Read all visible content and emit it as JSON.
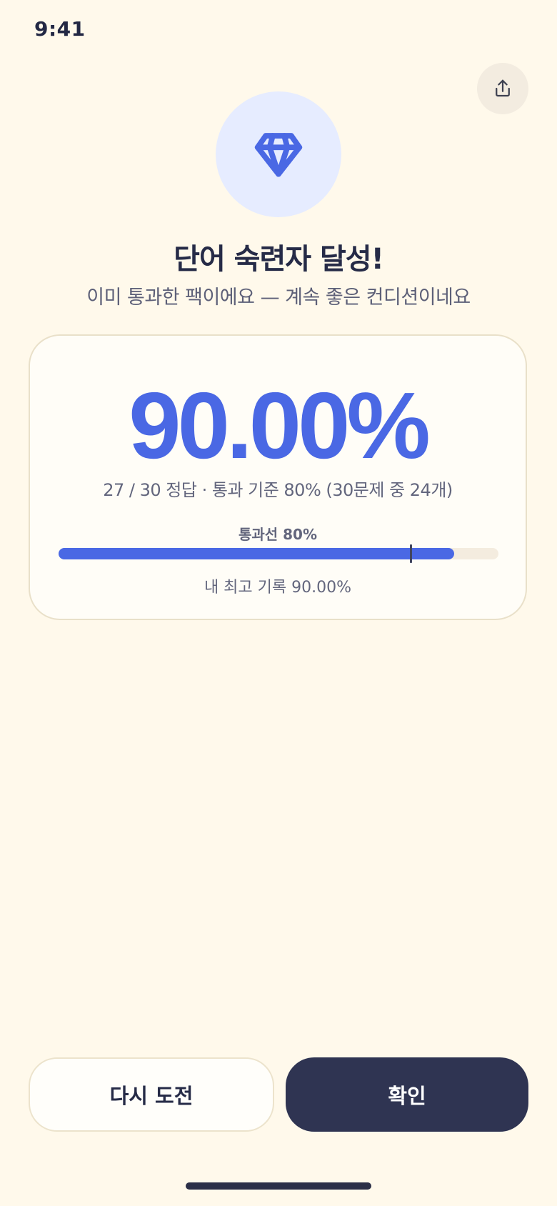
{
  "status_bar": {
    "time": "9:41"
  },
  "share": {
    "icon": "share-icon"
  },
  "hero": {
    "icon": "diamond-icon",
    "accent": "#4a68e4",
    "circle_bg": "#e6ecff"
  },
  "title": "단어 숙련자 달성!",
  "subtitle": "이미 통과한 팩이에요 — 계속 좋은 컨디션이네요",
  "result": {
    "score": "90.00%",
    "detail": "27 / 30 정답 · 통과 기준 80% (30문제 중 24개)",
    "pass_label": "통과선 80%",
    "progress_fraction": 0.9,
    "pass_fraction": 0.8,
    "best_record": "내 최고 기록 90.00%"
  },
  "buttons": {
    "retry": "다시 도전",
    "confirm": "확인"
  },
  "colors": {
    "background": "#fff9eb",
    "primary": "#4a68e4",
    "dark_button": "#2f3452"
  }
}
